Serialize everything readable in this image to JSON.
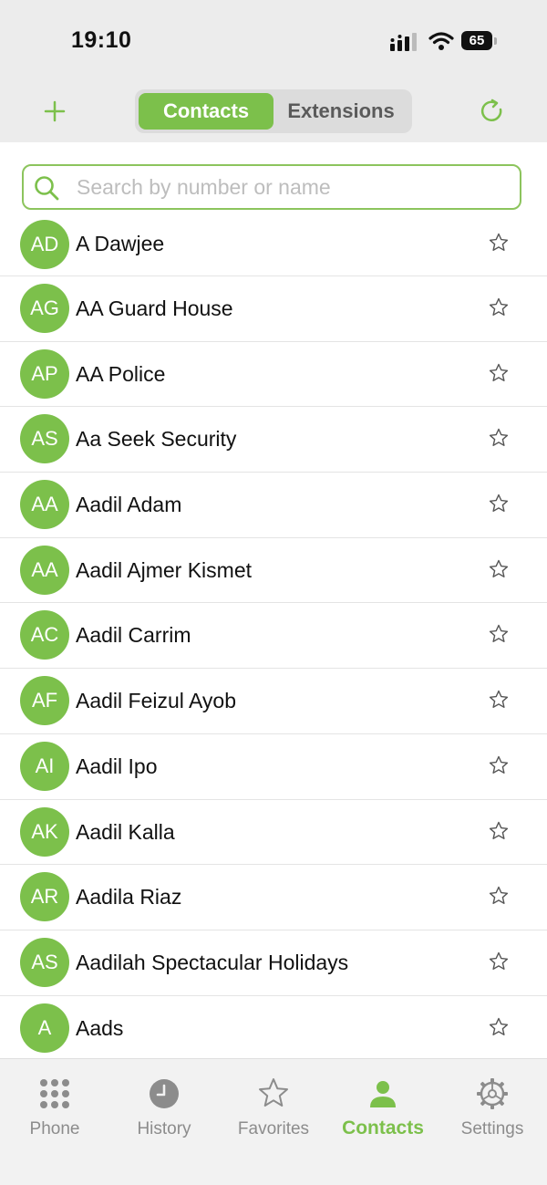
{
  "status_bar": {
    "time": "19:10",
    "battery": "65"
  },
  "header": {
    "segments": {
      "contacts": "Contacts",
      "extensions": "Extensions"
    },
    "selected": "contacts"
  },
  "search": {
    "placeholder": "Search by number or name",
    "value": ""
  },
  "contacts": [
    {
      "initials": "AD",
      "name": "A Dawjee"
    },
    {
      "initials": "AG",
      "name": "AA Guard House"
    },
    {
      "initials": "AP",
      "name": "AA Police"
    },
    {
      "initials": "AS",
      "name": "Aa Seek Security"
    },
    {
      "initials": "AA",
      "name": "Aadil Adam"
    },
    {
      "initials": "AA",
      "name": "Aadil Ajmer Kismet"
    },
    {
      "initials": "AC",
      "name": "Aadil Carrim"
    },
    {
      "initials": "AF",
      "name": "Aadil Feizul Ayob"
    },
    {
      "initials": "AI",
      "name": "Aadil Ipo"
    },
    {
      "initials": "AK",
      "name": "Aadil Kalla"
    },
    {
      "initials": "AR",
      "name": "Aadila Riaz"
    },
    {
      "initials": "AS",
      "name": "Aadilah Spectacular Holidays"
    },
    {
      "initials": "A",
      "name": "Aads"
    }
  ],
  "tabbar": {
    "items": [
      {
        "key": "phone",
        "label": "Phone",
        "icon": "keypad-icon"
      },
      {
        "key": "history",
        "label": "History",
        "icon": "clock-icon"
      },
      {
        "key": "favorites",
        "label": "Favorites",
        "icon": "star-icon"
      },
      {
        "key": "contacts",
        "label": "Contacts",
        "icon": "person-icon"
      },
      {
        "key": "settings",
        "label": "Settings",
        "icon": "gear-icon"
      }
    ],
    "active": "contacts"
  },
  "colors": {
    "accent": "#7cc04b",
    "inactive": "#8c8c8c",
    "top_background": "#ececec"
  }
}
